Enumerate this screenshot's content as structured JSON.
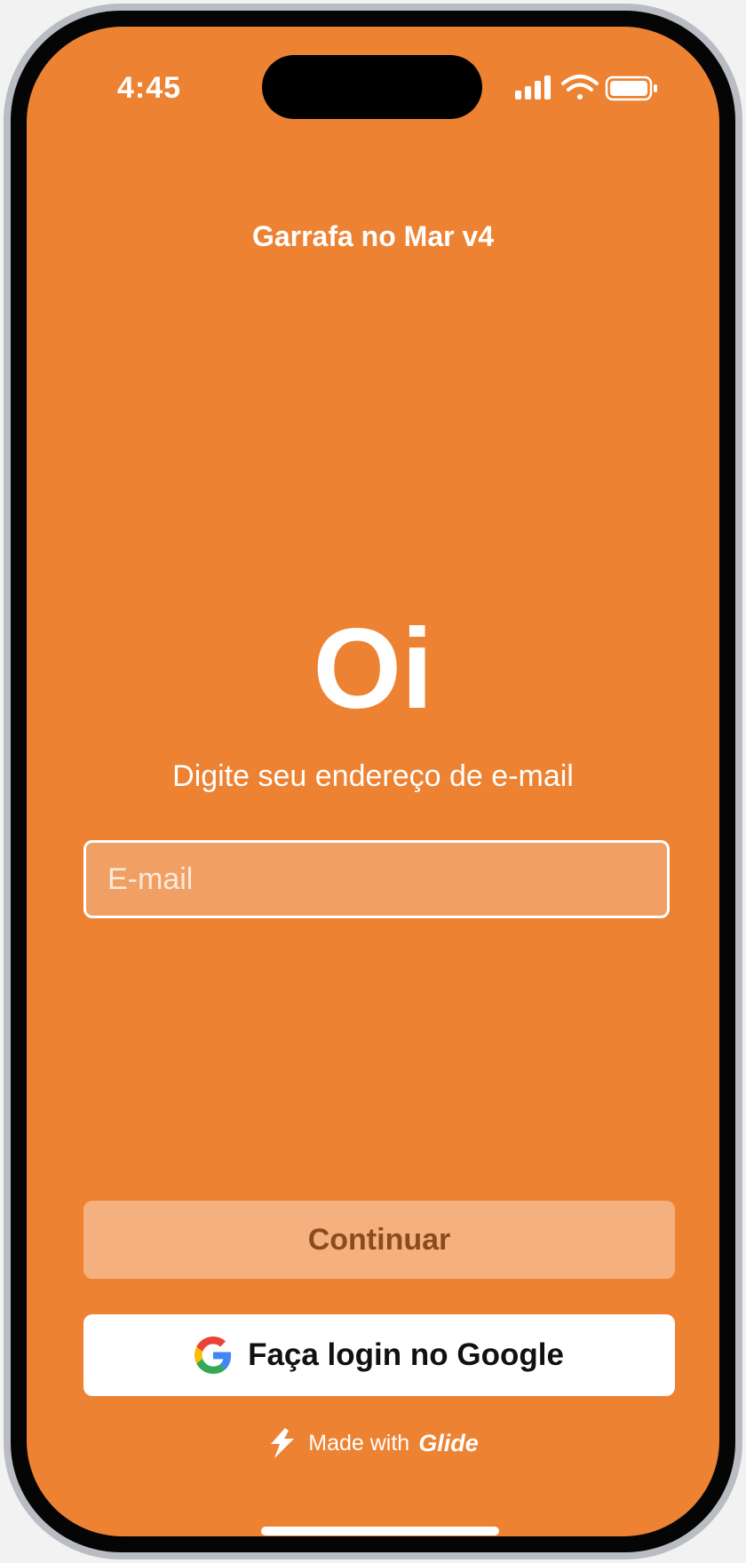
{
  "status_bar": {
    "time": "4:45",
    "icons": [
      "cellular-signal-icon",
      "wifi-icon",
      "battery-icon"
    ]
  },
  "app": {
    "title": "Garrafa no Mar v4"
  },
  "login": {
    "greeting": "Oi",
    "prompt": "Digite seu endereço de e-mail",
    "email_placeholder": "E-mail",
    "email_value": "",
    "continue_label": "Continuar",
    "google_label": "Faça login no Google",
    "google_icon": "google-icon"
  },
  "footer": {
    "made_with": "Made with",
    "brand": "Glide",
    "brand_icon": "glide-logo-icon"
  },
  "colors": {
    "background": "#ed8232",
    "field": "#f0a064",
    "continue": "#f4b17f",
    "continue_text": "#8b4b1c",
    "white": "#ffffff"
  }
}
